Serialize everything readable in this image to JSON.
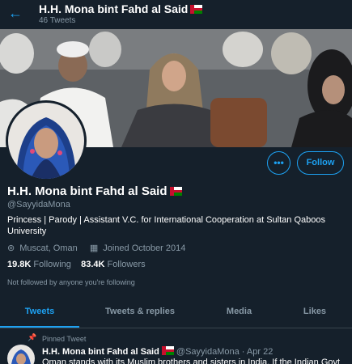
{
  "header": {
    "back_icon": "arrow-left-icon",
    "name": "H.H. Mona bint Fahd al Said",
    "tweet_count": "46 Tweets"
  },
  "profile": {
    "name": "H.H. Mona bint Fahd al Said",
    "handle": "@SayyidaMona",
    "bio": "Princess | Parody | Assistant V.C. for International Cooperation at Sultan Qaboos University",
    "location": "Muscat, Oman",
    "joined": "Joined October 2014",
    "following_count": "19.8K",
    "following_label": "Following",
    "followers_count": "83.4K",
    "followers_label": "Followers",
    "followed_note": "Not followed by anyone you're following",
    "more_label": "•••",
    "follow_label": "Follow"
  },
  "tabs": [
    {
      "label": "Tweets",
      "active": true
    },
    {
      "label": "Tweets & replies",
      "active": false
    },
    {
      "label": "Media",
      "active": false
    },
    {
      "label": "Likes",
      "active": false
    }
  ],
  "pinned_tweet": {
    "pinned_label": "Pinned Tweet",
    "author": "H.H. Mona bint Fahd al Said",
    "handle": "@SayyidaMona",
    "date": "· Apr 22",
    "text": "Oman stands with its Muslim brothers and sisters in India. If the Indian Govt"
  },
  "colors": {
    "background": "#15202b",
    "accent": "#1da1f2",
    "muted": "#8899a6",
    "divider": "#38444d"
  }
}
